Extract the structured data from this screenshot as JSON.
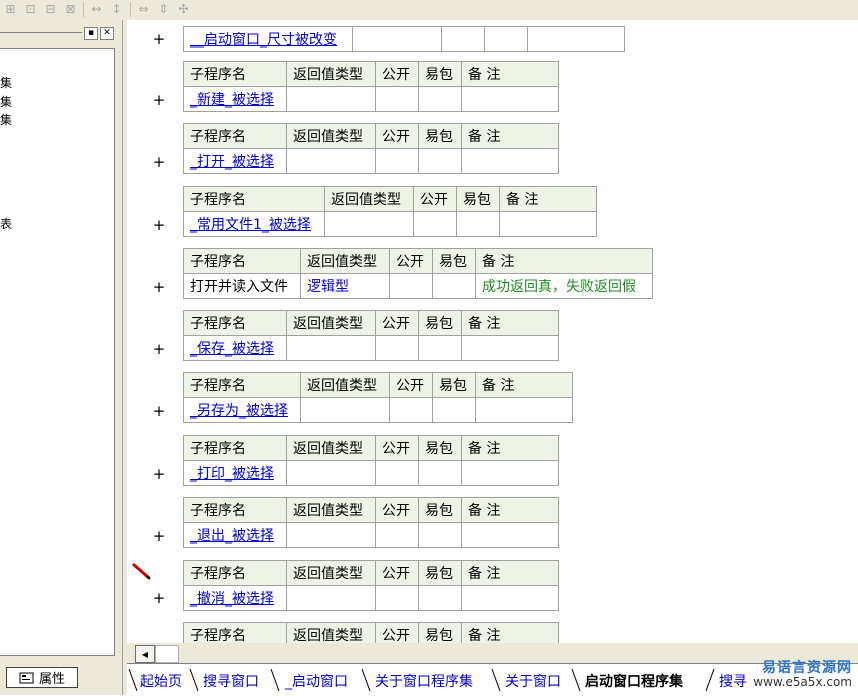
{
  "toolbar": {
    "buttons": [
      "align-left-icon",
      "align-center-icon",
      "align-top-icon",
      "align-bottom-icon",
      "space-horizontal-icon",
      "space-vertical-icon",
      "same-width-icon",
      "same-height-icon",
      "same-size-icon"
    ]
  },
  "left_panel": {
    "tree_fragments": [
      "集",
      "集",
      "集",
      "表"
    ],
    "properties_tab": "属性"
  },
  "editor": {
    "top_row": {
      "name": "__启动窗口_尺寸被改变"
    },
    "header": {
      "name": "子程序名",
      "return_type": "返回值类型",
      "public": "公开",
      "easy_pack": "易包",
      "remark": "备 注"
    },
    "subroutines": [
      {
        "name": "_新建_被选择",
        "return_type": "",
        "remark": ""
      },
      {
        "name": "_打开_被选择",
        "return_type": "",
        "remark": ""
      },
      {
        "name": "_常用文件1_被选择",
        "return_type": "",
        "remark": ""
      },
      {
        "name": "打开并读入文件",
        "return_type": "逻辑型",
        "remark": "成功返回真，失败返回假"
      },
      {
        "name": "_保存_被选择",
        "return_type": "",
        "remark": ""
      },
      {
        "name": "_另存为_被选择",
        "return_type": "",
        "remark": ""
      },
      {
        "name": "_打印_被选择",
        "return_type": "",
        "remark": ""
      },
      {
        "name": "_退出_被选择",
        "return_type": "",
        "remark": ""
      },
      {
        "name": "_撤消_被选择",
        "return_type": "",
        "remark": ""
      }
    ],
    "expand_symbol": "+"
  },
  "tabs": [
    "起始页",
    "搜寻窗口",
    "_启动窗口",
    "关于窗口程序集",
    "关于窗口",
    "启动窗口程序集",
    "搜寻"
  ],
  "active_tab": "启动窗口程序集",
  "watermark": {
    "title": "易语言资源网",
    "url": "www.e5a5x.com"
  }
}
